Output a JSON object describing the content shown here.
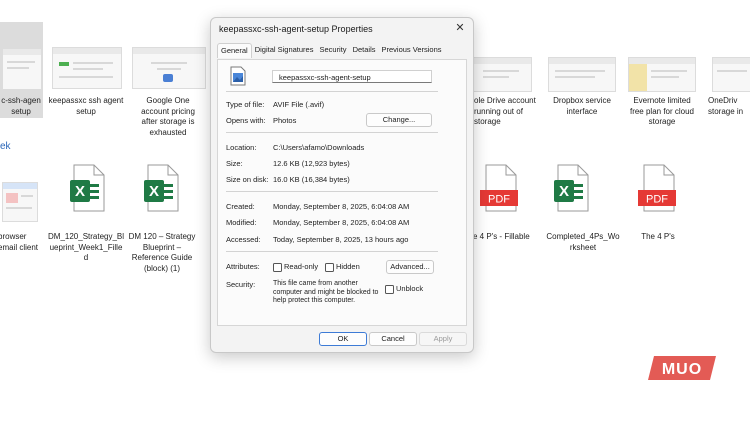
{
  "background": {
    "section_header": "ek",
    "top_row": [
      {
        "label": "c-ssh-agen\nsetup",
        "selected": true
      },
      {
        "label": "keepassxc ssh agent\nsetup"
      },
      {
        "label": "Google One\naccount pricing\nafter storage is\nexhausted"
      },
      {
        "label": "ole Drive account\nrunning out of\nstorage"
      },
      {
        "label": "Dropbox service\ninterface"
      },
      {
        "label": "Evernote limited\nfree plan for cloud\nstorage"
      },
      {
        "label": "OneDriv\nstorage in"
      }
    ],
    "bottom_row": [
      {
        "label": "browser\nemail client",
        "kind": "image"
      },
      {
        "label": "DM_120_Strategy_Bl\nueprint_Week1_Fille\nd",
        "kind": "excel"
      },
      {
        "label": "DM 120 – Strategy\nBlueprint –\nReference Guide\n(block) (1)",
        "kind": "excel"
      },
      {
        "label": "e 4 P's - Fillable",
        "kind": "pdf"
      },
      {
        "label": "Completed_4Ps_Wo\nrksheet",
        "kind": "excel"
      },
      {
        "label": "The 4 P's",
        "kind": "pdf"
      }
    ],
    "icon_texts": {
      "excel": "X",
      "pdf": "PDF"
    }
  },
  "dialog": {
    "title": "keepassxc-ssh-agent-setup Properties",
    "close_glyph": "✕",
    "tabs": [
      "General",
      "Digital Signatures",
      "Security",
      "Details",
      "Previous Versions"
    ],
    "active_tab": "General",
    "file_name": "keepassxc-ssh-agent-setup",
    "type_label": "Type of file:",
    "type_value": "AVIF File (.avif)",
    "opens_label": "Opens with:",
    "opens_value": "Photos",
    "change_button": "Change...",
    "location_label": "Location:",
    "location_value": "C:\\Users\\afamo\\Downloads",
    "size_label": "Size:",
    "size_value": "12.6 KB (12,923 bytes)",
    "size_disk_label": "Size on disk:",
    "size_disk_value": "16.0 KB (16,384 bytes)",
    "created_label": "Created:",
    "created_value": "Monday, September 8, 2025, 6:04:08 AM",
    "modified_label": "Modified:",
    "modified_value": "Monday, September 8, 2025, 6:04:08 AM",
    "accessed_label": "Accessed:",
    "accessed_value": "Today, September 8, 2025, 13 hours ago",
    "attributes_label": "Attributes:",
    "readonly_label": "Read-only",
    "hidden_label": "Hidden",
    "advanced_button": "Advanced...",
    "security_label": "Security:",
    "security_text": "This file came from another\ncomputer and might be blocked to\nhelp protect this computer.",
    "unblock_label": "Unblock",
    "ok_button": "OK",
    "cancel_button": "Cancel",
    "apply_button": "Apply"
  },
  "watermark": {
    "text": "MUO",
    "color": "#e35b55"
  },
  "colors": {
    "excel_green": "#1f7a45",
    "pdf_red": "#e53935",
    "link_blue": "#2a66b8",
    "accent_blue": "#3d7bd6"
  }
}
